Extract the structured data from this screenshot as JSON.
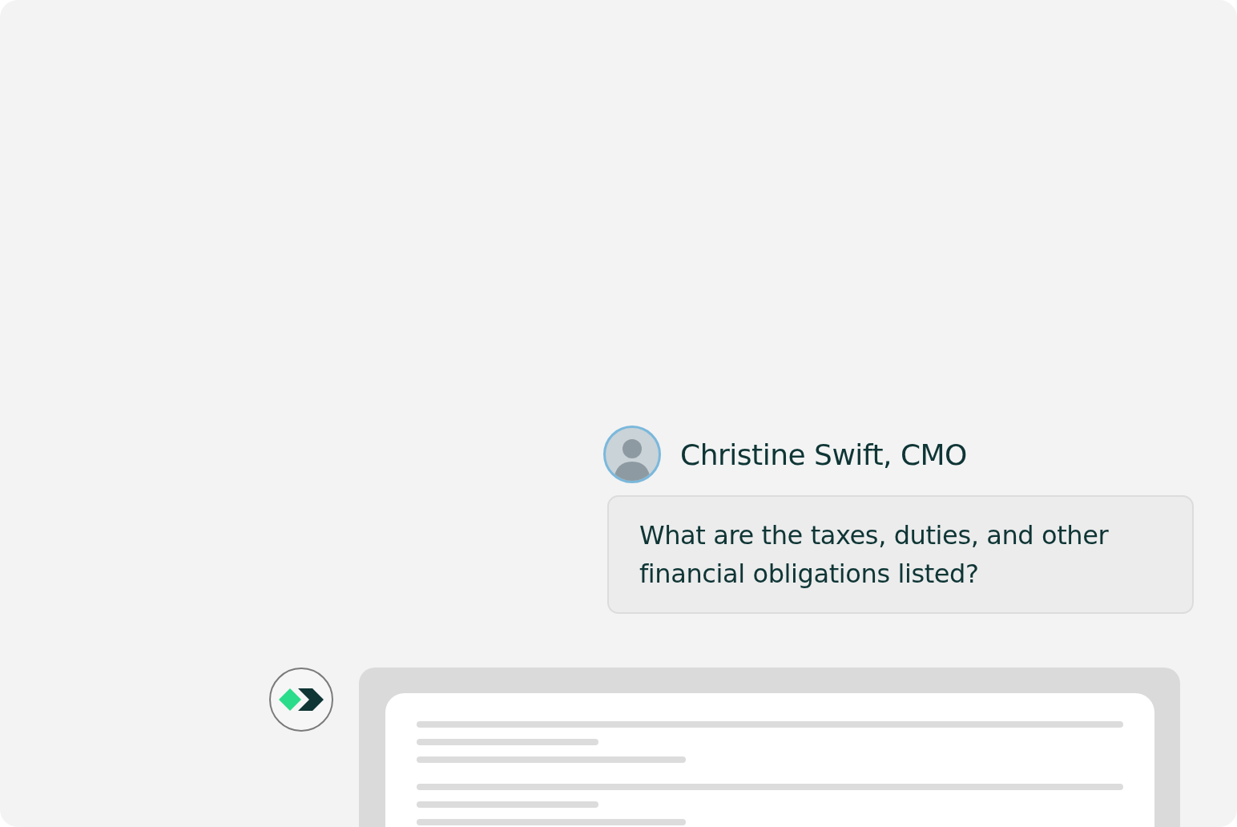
{
  "user_message": {
    "author": "Christine Swift, CMO",
    "text": "What are the taxes, duties, and other financial obligations listed?"
  }
}
